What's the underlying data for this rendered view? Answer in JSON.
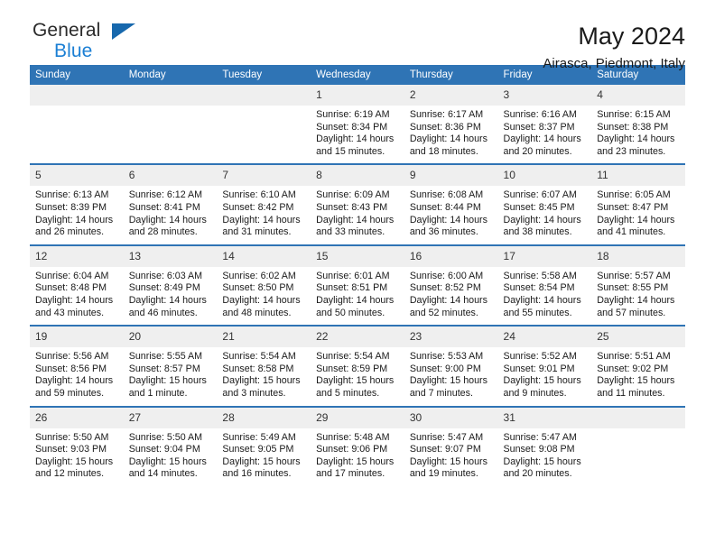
{
  "brand": {
    "name_top": "General",
    "name_bottom": "Blue",
    "triangle_icon": "brand-triangle-icon",
    "accent_color": "#1b7fd4"
  },
  "header": {
    "title": "May 2024",
    "subtitle": "Airasca, Piedmont, Italy"
  },
  "theme": {
    "header_blue": "#2f74b5",
    "daynum_gray": "#efefef"
  },
  "calendar": {
    "weekday_headers": [
      "Sunday",
      "Monday",
      "Tuesday",
      "Wednesday",
      "Thursday",
      "Friday",
      "Saturday"
    ],
    "weeks": [
      [
        {
          "day": "",
          "empty": true
        },
        {
          "day": "",
          "empty": true
        },
        {
          "day": "",
          "empty": true
        },
        {
          "day": "1",
          "sunrise": "Sunrise: 6:19 AM",
          "sunset": "Sunset: 8:34 PM",
          "daylight": "Daylight: 14 hours and 15 minutes."
        },
        {
          "day": "2",
          "sunrise": "Sunrise: 6:17 AM",
          "sunset": "Sunset: 8:36 PM",
          "daylight": "Daylight: 14 hours and 18 minutes."
        },
        {
          "day": "3",
          "sunrise": "Sunrise: 6:16 AM",
          "sunset": "Sunset: 8:37 PM",
          "daylight": "Daylight: 14 hours and 20 minutes."
        },
        {
          "day": "4",
          "sunrise": "Sunrise: 6:15 AM",
          "sunset": "Sunset: 8:38 PM",
          "daylight": "Daylight: 14 hours and 23 minutes."
        }
      ],
      [
        {
          "day": "5",
          "sunrise": "Sunrise: 6:13 AM",
          "sunset": "Sunset: 8:39 PM",
          "daylight": "Daylight: 14 hours and 26 minutes."
        },
        {
          "day": "6",
          "sunrise": "Sunrise: 6:12 AM",
          "sunset": "Sunset: 8:41 PM",
          "daylight": "Daylight: 14 hours and 28 minutes."
        },
        {
          "day": "7",
          "sunrise": "Sunrise: 6:10 AM",
          "sunset": "Sunset: 8:42 PM",
          "daylight": "Daylight: 14 hours and 31 minutes."
        },
        {
          "day": "8",
          "sunrise": "Sunrise: 6:09 AM",
          "sunset": "Sunset: 8:43 PM",
          "daylight": "Daylight: 14 hours and 33 minutes."
        },
        {
          "day": "9",
          "sunrise": "Sunrise: 6:08 AM",
          "sunset": "Sunset: 8:44 PM",
          "daylight": "Daylight: 14 hours and 36 minutes."
        },
        {
          "day": "10",
          "sunrise": "Sunrise: 6:07 AM",
          "sunset": "Sunset: 8:45 PM",
          "daylight": "Daylight: 14 hours and 38 minutes."
        },
        {
          "day": "11",
          "sunrise": "Sunrise: 6:05 AM",
          "sunset": "Sunset: 8:47 PM",
          "daylight": "Daylight: 14 hours and 41 minutes."
        }
      ],
      [
        {
          "day": "12",
          "sunrise": "Sunrise: 6:04 AM",
          "sunset": "Sunset: 8:48 PM",
          "daylight": "Daylight: 14 hours and 43 minutes."
        },
        {
          "day": "13",
          "sunrise": "Sunrise: 6:03 AM",
          "sunset": "Sunset: 8:49 PM",
          "daylight": "Daylight: 14 hours and 46 minutes."
        },
        {
          "day": "14",
          "sunrise": "Sunrise: 6:02 AM",
          "sunset": "Sunset: 8:50 PM",
          "daylight": "Daylight: 14 hours and 48 minutes."
        },
        {
          "day": "15",
          "sunrise": "Sunrise: 6:01 AM",
          "sunset": "Sunset: 8:51 PM",
          "daylight": "Daylight: 14 hours and 50 minutes."
        },
        {
          "day": "16",
          "sunrise": "Sunrise: 6:00 AM",
          "sunset": "Sunset: 8:52 PM",
          "daylight": "Daylight: 14 hours and 52 minutes."
        },
        {
          "day": "17",
          "sunrise": "Sunrise: 5:58 AM",
          "sunset": "Sunset: 8:54 PM",
          "daylight": "Daylight: 14 hours and 55 minutes."
        },
        {
          "day": "18",
          "sunrise": "Sunrise: 5:57 AM",
          "sunset": "Sunset: 8:55 PM",
          "daylight": "Daylight: 14 hours and 57 minutes."
        }
      ],
      [
        {
          "day": "19",
          "sunrise": "Sunrise: 5:56 AM",
          "sunset": "Sunset: 8:56 PM",
          "daylight": "Daylight: 14 hours and 59 minutes."
        },
        {
          "day": "20",
          "sunrise": "Sunrise: 5:55 AM",
          "sunset": "Sunset: 8:57 PM",
          "daylight": "Daylight: 15 hours and 1 minute."
        },
        {
          "day": "21",
          "sunrise": "Sunrise: 5:54 AM",
          "sunset": "Sunset: 8:58 PM",
          "daylight": "Daylight: 15 hours and 3 minutes."
        },
        {
          "day": "22",
          "sunrise": "Sunrise: 5:54 AM",
          "sunset": "Sunset: 8:59 PM",
          "daylight": "Daylight: 15 hours and 5 minutes."
        },
        {
          "day": "23",
          "sunrise": "Sunrise: 5:53 AM",
          "sunset": "Sunset: 9:00 PM",
          "daylight": "Daylight: 15 hours and 7 minutes."
        },
        {
          "day": "24",
          "sunrise": "Sunrise: 5:52 AM",
          "sunset": "Sunset: 9:01 PM",
          "daylight": "Daylight: 15 hours and 9 minutes."
        },
        {
          "day": "25",
          "sunrise": "Sunrise: 5:51 AM",
          "sunset": "Sunset: 9:02 PM",
          "daylight": "Daylight: 15 hours and 11 minutes."
        }
      ],
      [
        {
          "day": "26",
          "sunrise": "Sunrise: 5:50 AM",
          "sunset": "Sunset: 9:03 PM",
          "daylight": "Daylight: 15 hours and 12 minutes."
        },
        {
          "day": "27",
          "sunrise": "Sunrise: 5:50 AM",
          "sunset": "Sunset: 9:04 PM",
          "daylight": "Daylight: 15 hours and 14 minutes."
        },
        {
          "day": "28",
          "sunrise": "Sunrise: 5:49 AM",
          "sunset": "Sunset: 9:05 PM",
          "daylight": "Daylight: 15 hours and 16 minutes."
        },
        {
          "day": "29",
          "sunrise": "Sunrise: 5:48 AM",
          "sunset": "Sunset: 9:06 PM",
          "daylight": "Daylight: 15 hours and 17 minutes."
        },
        {
          "day": "30",
          "sunrise": "Sunrise: 5:47 AM",
          "sunset": "Sunset: 9:07 PM",
          "daylight": "Daylight: 15 hours and 19 minutes."
        },
        {
          "day": "31",
          "sunrise": "Sunrise: 5:47 AM",
          "sunset": "Sunset: 9:08 PM",
          "daylight": "Daylight: 15 hours and 20 minutes."
        },
        {
          "day": "",
          "empty": true
        }
      ]
    ]
  }
}
